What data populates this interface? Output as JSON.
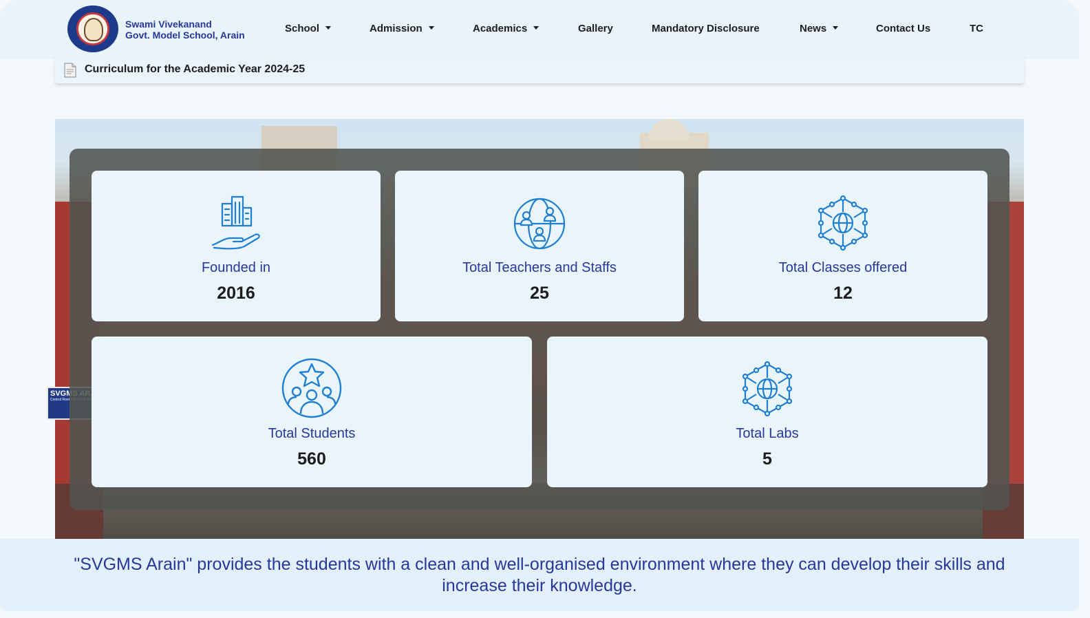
{
  "header": {
    "school_name_line1": "Swami Vivekanand",
    "school_name_line2": "Govt. Model School, Arain",
    "nav": [
      {
        "label": "School",
        "dropdown": true
      },
      {
        "label": "Admission",
        "dropdown": true
      },
      {
        "label": "Academics",
        "dropdown": true
      },
      {
        "label": "Gallery",
        "dropdown": false
      },
      {
        "label": "Mandatory Disclosure",
        "dropdown": false
      },
      {
        "label": "News",
        "dropdown": true
      },
      {
        "label": "Contact Us",
        "dropdown": false
      },
      {
        "label": "TC",
        "dropdown": false
      }
    ]
  },
  "notice": {
    "icon": "document-icon",
    "text": "Curriculum for the Academic Year 2024-25"
  },
  "hero": {
    "sign_title": "SVGMS ARAIN",
    "sign_subtitle": "Control Room And Help line No."
  },
  "stats": [
    {
      "icon": "building-hand-icon",
      "label": "Founded in",
      "value": "2016"
    },
    {
      "icon": "globe-people-icon",
      "label": "Total Teachers and Staffs",
      "value": "25"
    },
    {
      "icon": "network-globe-icon",
      "label": "Total Classes offered",
      "value": "12"
    },
    {
      "icon": "students-star-icon",
      "label": "Total Students",
      "value": "560"
    },
    {
      "icon": "network-globe-icon",
      "label": "Total Labs",
      "value": "5"
    }
  ],
  "tagline": "\"SVGMS Arain\" provides the students with a clean and well-organised environment where they can develop their skills and increase their knowledge.",
  "colors": {
    "accent": "#26389b",
    "icon": "#1f7fd1",
    "header_bg": "#e9f3fb",
    "card_bg": "#eaf4fb"
  }
}
